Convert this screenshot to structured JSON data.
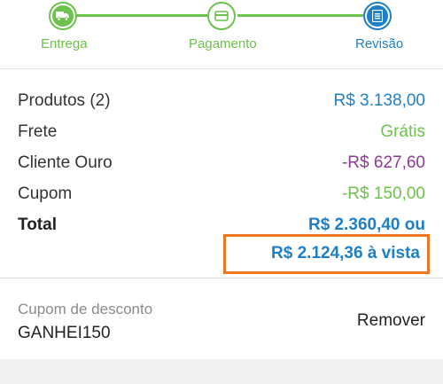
{
  "stepper": {
    "steps": [
      {
        "label": "Entrega",
        "icon": "truck-icon",
        "state": "done"
      },
      {
        "label": "Pagamento",
        "icon": "card-icon",
        "state": "done"
      },
      {
        "label": "Revisão",
        "icon": "list-icon",
        "state": "current"
      }
    ],
    "colors": {
      "done": "#6cc24a",
      "current": "#1f7fc6"
    }
  },
  "summary": {
    "rows": [
      {
        "label": "Produtos (2)",
        "value": "R$ 3.138,00"
      },
      {
        "label": "Frete",
        "value": "Grátis"
      },
      {
        "label": "Cliente Ouro",
        "value": "-R$ 627,60"
      },
      {
        "label": "Cupom",
        "value": "-R$ 150,00"
      }
    ],
    "total": {
      "label": "Total",
      "value": "R$ 2.360,40 ou",
      "cash_value": "R$ 2.124,36 à vista"
    }
  },
  "coupon": {
    "label": "Cupom de desconto",
    "code": "GANHEI150",
    "remove_label": "Remover"
  },
  "colors": {
    "blue": "#1f7fc6",
    "green": "#6cc24a",
    "purple": "#8e3a96",
    "highlight": "#f07722"
  }
}
